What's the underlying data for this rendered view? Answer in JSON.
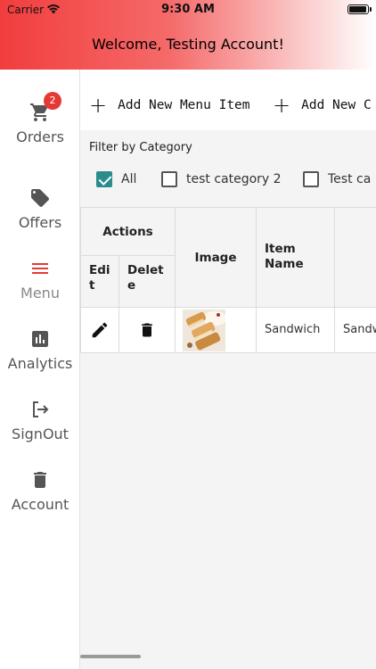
{
  "status_bar": {
    "carrier": "Carrier",
    "time": "9:30 AM"
  },
  "header": {
    "welcome": "Welcome, Testing Account!"
  },
  "sidebar": {
    "items": [
      {
        "label": "Orders",
        "icon": "cart-icon",
        "badge": "2"
      },
      {
        "label": "Offers",
        "icon": "tag-icon"
      },
      {
        "label": "Menu",
        "icon": "menu-icon",
        "active": true
      },
      {
        "label": "Analytics",
        "icon": "bar-chart-icon"
      },
      {
        "label": "SignOut",
        "icon": "sign-out-icon"
      },
      {
        "label": "Account",
        "icon": "trash-icon"
      }
    ]
  },
  "toolbar": {
    "add_item_label": "Add New Menu Item",
    "add_category_label": "Add New C"
  },
  "filter": {
    "title": "Filter by Category",
    "options": [
      {
        "label": "All",
        "checked": true
      },
      {
        "label": "test category 2",
        "checked": false
      },
      {
        "label": "Test ca",
        "checked": false
      }
    ]
  },
  "table": {
    "headers": {
      "actions": "Actions",
      "edit": "Edi\nt",
      "delete": "Delet\ne",
      "image": "Image",
      "item_name": "Item\nName"
    },
    "rows": [
      {
        "item_name": "Sandwich",
        "next_col": "Sandw"
      }
    ]
  },
  "colors": {
    "header_gradient_start": "#f23d3d",
    "badge": "#e53935",
    "active_menu_icon": "#e53935",
    "checkbox_checked": "#2a8c8c"
  }
}
